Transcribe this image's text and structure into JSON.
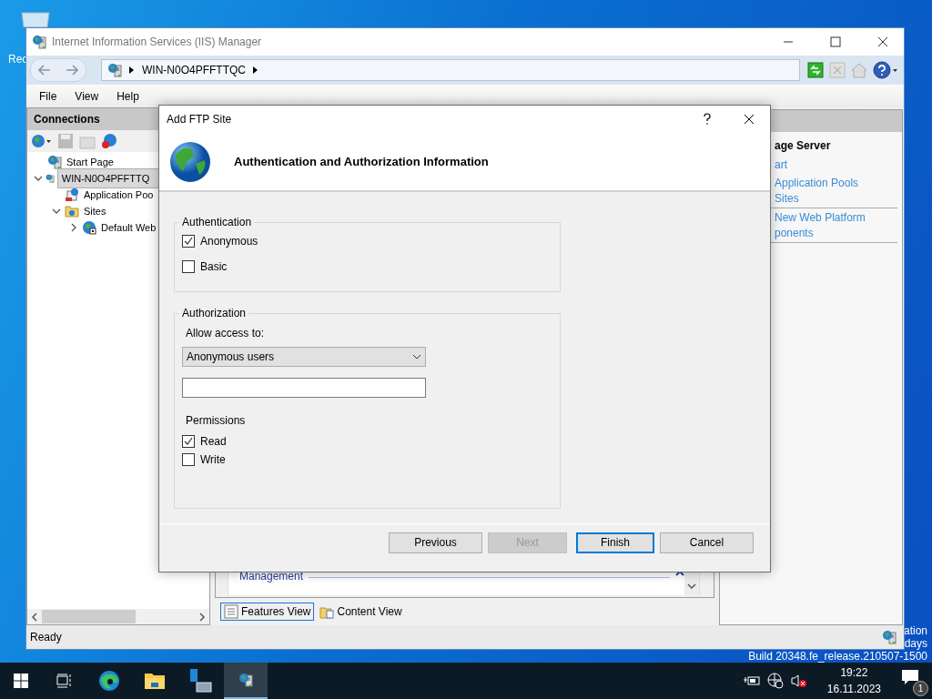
{
  "desktop": {
    "icon_label": "Rec",
    "activation_lines": [
      "ation",
      "days",
      "Build 20348.fe_release.210507-1500"
    ]
  },
  "window": {
    "title": "Internet Information Services (IIS) Manager"
  },
  "address_bar": {
    "segments": [
      "WIN-N0O4PFFTTQC"
    ]
  },
  "menu": [
    "File",
    "View",
    "Help"
  ],
  "connections": {
    "title": "Connections",
    "tree": [
      {
        "label": "Start Page",
        "selected": false,
        "kind": "server"
      },
      {
        "label": "WIN-N0O4PFFTTQ",
        "selected": true,
        "expanded": true,
        "kind": "server",
        "children": [
          {
            "label": "Application Poo",
            "selected": false,
            "kind": "pool"
          },
          {
            "label": "Sites",
            "selected": false,
            "expanded": true,
            "kind": "folder",
            "children": [
              {
                "label": "Default Web",
                "selected": false,
                "expanded": false,
                "kind": "site"
              }
            ]
          }
        ]
      }
    ]
  },
  "center": {
    "group": "Management",
    "view_tabs": [
      {
        "label": "Features View",
        "selected": true
      },
      {
        "label": "Content View",
        "selected": false
      }
    ]
  },
  "actions": {
    "heading": "age Server",
    "groups": [
      [
        "art"
      ],
      [
        "Application Pools",
        "Sites"
      ],
      [
        "New Web Platform",
        "ponents"
      ]
    ]
  },
  "status_bar": "Ready",
  "dialog": {
    "title": "Add FTP Site",
    "heading": "Authentication and Authorization Information",
    "authentication": {
      "title": "Authentication",
      "options": [
        {
          "label": "Anonymous",
          "checked": true
        },
        {
          "label": "Basic",
          "checked": false
        }
      ]
    },
    "authorization": {
      "title": "Authorization",
      "allow_label": "Allow access to:",
      "allow_value": "Anonymous users",
      "permissions_title": "Permissions",
      "permissions": [
        {
          "label": "Read",
          "checked": true
        },
        {
          "label": "Write",
          "checked": false
        }
      ]
    },
    "buttons": [
      {
        "label": "Previous",
        "disabled": false,
        "focused": false
      },
      {
        "label": "Next",
        "disabled": true,
        "focused": false
      },
      {
        "label": "Finish",
        "disabled": false,
        "focused": true
      },
      {
        "label": "Cancel",
        "disabled": false,
        "focused": false
      }
    ]
  },
  "taskbar": {
    "apps": [
      {
        "kind": "start",
        "selected": false
      },
      {
        "kind": "taskview",
        "selected": false
      },
      {
        "kind": "edge",
        "selected": false
      },
      {
        "kind": "explorer",
        "selected": false
      },
      {
        "kind": "servermanager",
        "selected": false
      },
      {
        "kind": "iis",
        "selected": true
      }
    ],
    "time": "19:22",
    "date": "16.11.2023",
    "notification_count": "1"
  }
}
